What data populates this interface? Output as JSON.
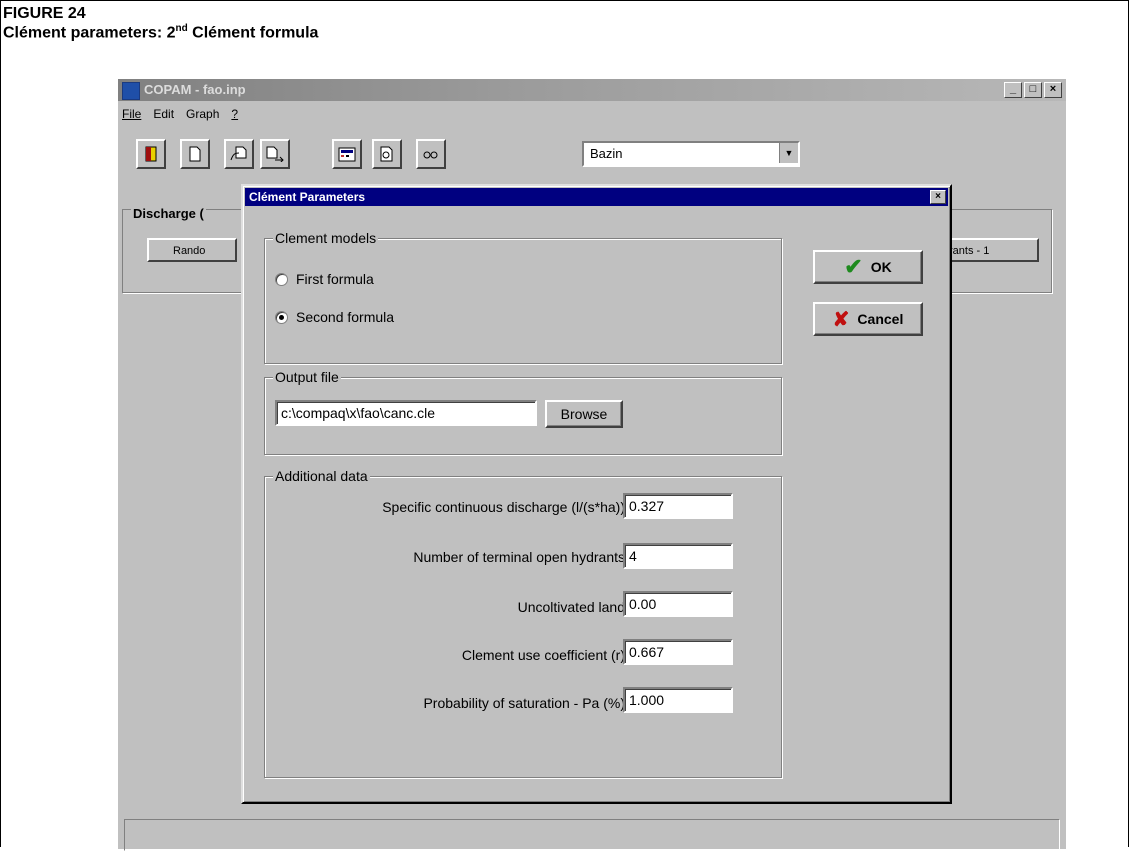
{
  "figure": {
    "number": "FIGURE 24",
    "title_pre": "Clément parameters: 2",
    "title_sup": "nd",
    "title_post": " Clément formula"
  },
  "app": {
    "title": "COPAM - fao.inp",
    "menu": [
      "File",
      "Edit",
      "Graph",
      "?"
    ],
    "toolbar_icons": [
      "exit-icon",
      "new-file-icon",
      "open-file-icon",
      "save-file-icon",
      "calculator-icon",
      "preview-icon",
      "view-icon"
    ],
    "formula_select": "Bazin",
    "discharge_group_label": "Discharge (",
    "random_button": "Rando",
    "hydrants_button": "rants - 1"
  },
  "dialog": {
    "title": "Clément Parameters",
    "models_legend": "Clement models",
    "first_formula": "First formula",
    "second_formula": "Second formula",
    "selected_model": "Second formula",
    "output_legend": "Output file",
    "output_path": "c:\\compaq\\x\\fao\\canc.cle",
    "browse": "Browse",
    "additional_legend": "Additional data",
    "fields": [
      {
        "label": "Specific continuous discharge (l/(s*ha))",
        "value": "0.327"
      },
      {
        "label": "Number of terminal open hydrants",
        "value": "4"
      },
      {
        "label": "Uncoltivated land",
        "value": "0.00"
      },
      {
        "label": "Clement use coefficient (r)",
        "value": "0.667"
      },
      {
        "label": "Probability of saturation -  Pa (%)",
        "value": "1.000"
      }
    ],
    "ok": "OK",
    "cancel": "Cancel"
  }
}
